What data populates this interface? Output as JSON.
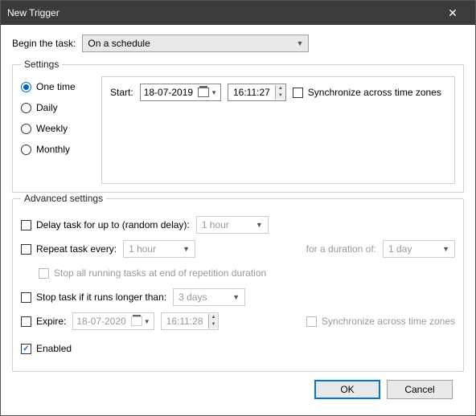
{
  "title": "New Trigger",
  "begin": {
    "label": "Begin the task:",
    "value": "On a schedule"
  },
  "settings": {
    "legend": "Settings",
    "schedule": {
      "options": [
        "One time",
        "Daily",
        "Weekly",
        "Monthly"
      ],
      "selected": "One time"
    },
    "start": {
      "label": "Start:",
      "date": "18-07-2019",
      "time": "16:11:27",
      "sync_label": "Synchronize across time zones"
    }
  },
  "advanced": {
    "legend": "Advanced settings",
    "delay": {
      "label": "Delay task for up to (random delay):",
      "value": "1 hour"
    },
    "repeat": {
      "label": "Repeat task every:",
      "value": "1 hour",
      "duration_label": "for a duration of:",
      "duration_value": "1 day"
    },
    "stop_repeat": "Stop all running tasks at end of repetition duration",
    "stop_longer": {
      "label": "Stop task if it runs longer than:",
      "value": "3 days"
    },
    "expire": {
      "label": "Expire:",
      "date": "18-07-2020",
      "time": "16:11:28",
      "sync_label": "Synchronize across time zones"
    },
    "enabled": "Enabled"
  },
  "buttons": {
    "ok": "OK",
    "cancel": "Cancel"
  }
}
